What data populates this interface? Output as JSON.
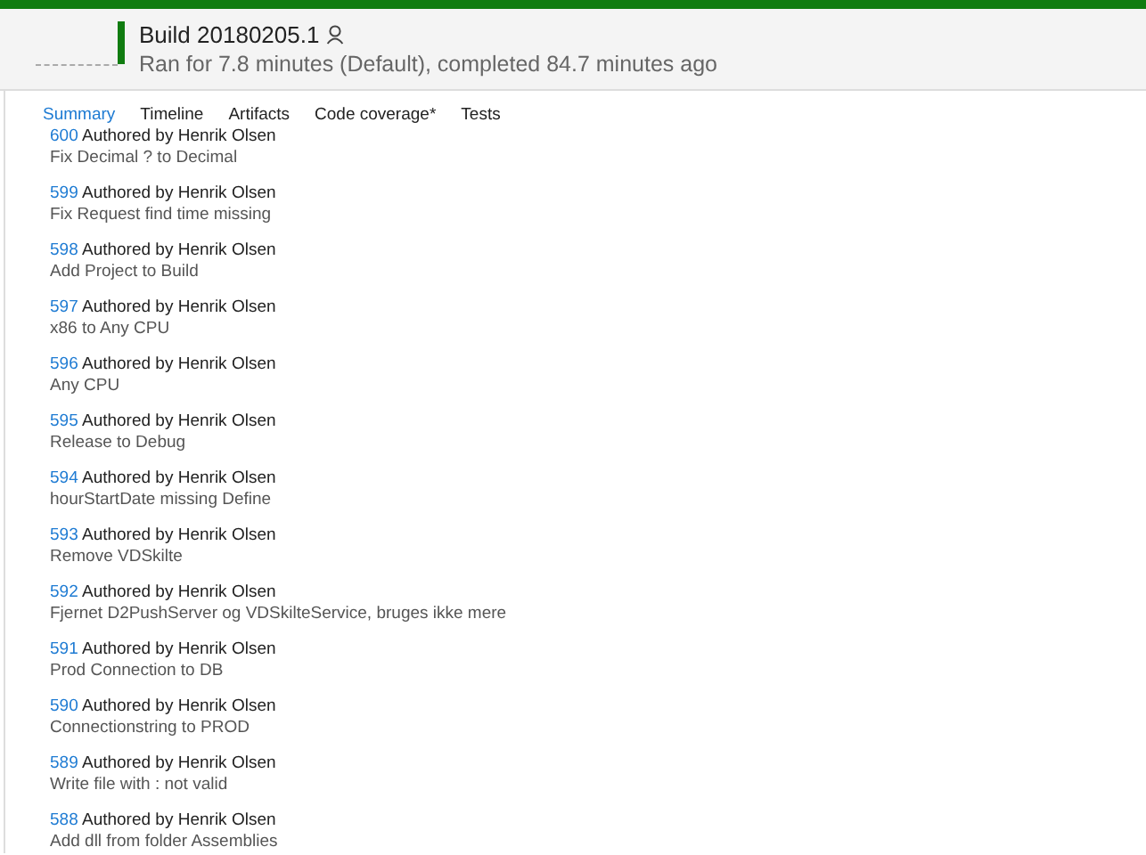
{
  "build": {
    "title": "Build 20180205.1",
    "succeeded": true,
    "subtitle": "Ran for 7.8 minutes (Default), completed 84.7 minutes ago"
  },
  "tabs": [
    {
      "label": "Summary",
      "selected": true
    },
    {
      "label": "Timeline",
      "selected": false
    },
    {
      "label": "Artifacts",
      "selected": false
    },
    {
      "label": "Code coverage*",
      "selected": false
    },
    {
      "label": "Tests",
      "selected": false
    }
  ],
  "commits": [
    {
      "id": "600",
      "author": "Authored by Henrik Olsen",
      "message": "Fix Decimal ? to Decimal"
    },
    {
      "id": "599",
      "author": "Authored by Henrik Olsen",
      "message": "Fix Request find time missing"
    },
    {
      "id": "598",
      "author": "Authored by Henrik Olsen",
      "message": "Add Project to Build"
    },
    {
      "id": "597",
      "author": "Authored by Henrik Olsen",
      "message": "x86 to Any CPU"
    },
    {
      "id": "596",
      "author": "Authored by Henrik Olsen",
      "message": "Any CPU"
    },
    {
      "id": "595",
      "author": "Authored by Henrik Olsen",
      "message": "Release to Debug"
    },
    {
      "id": "594",
      "author": "Authored by Henrik Olsen",
      "message": "hourStartDate missing Define"
    },
    {
      "id": "593",
      "author": "Authored by Henrik Olsen",
      "message": "Remove VDSkilte"
    },
    {
      "id": "592",
      "author": "Authored by Henrik Olsen",
      "message": "Fjernet D2PushServer og VDSkilteService, bruges ikke mere"
    },
    {
      "id": "591",
      "author": "Authored by Henrik Olsen",
      "message": "Prod Connection to DB"
    },
    {
      "id": "590",
      "author": "Authored by Henrik Olsen",
      "message": "Connectionstring to PROD"
    },
    {
      "id": "589",
      "author": "Authored by Henrik Olsen",
      "message": "Write file with : not valid"
    },
    {
      "id": "588",
      "author": "Authored by Henrik Olsen",
      "message": "Add dll from folder Assemblies"
    }
  ]
}
